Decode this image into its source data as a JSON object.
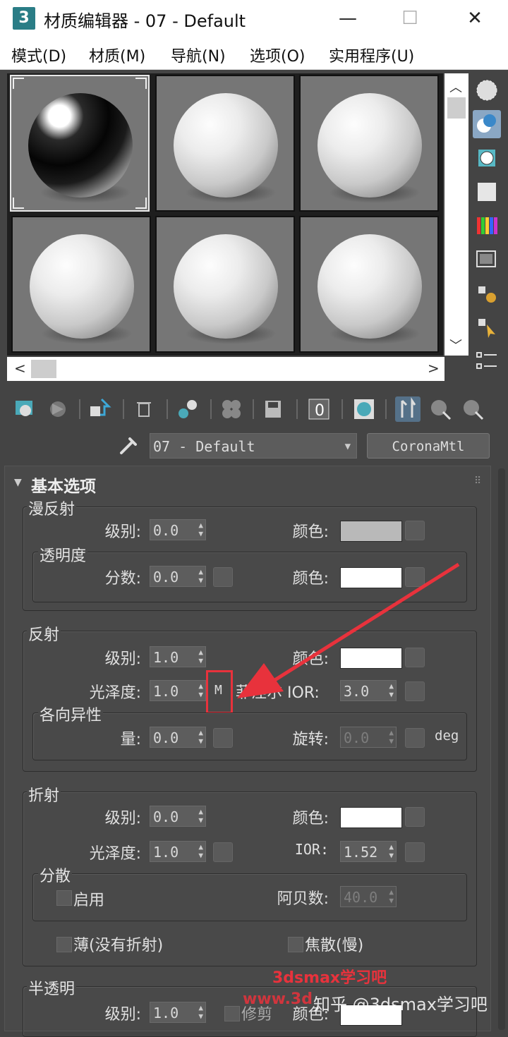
{
  "window": {
    "icon_label": "3",
    "title": "材质编辑器 - 07 - Default",
    "minimize": "—",
    "maximize": "☐",
    "close": "✕"
  },
  "menu": [
    "模式(D)",
    "材质(M)",
    "导航(N)",
    "选项(O)",
    "实用程序(U)"
  ],
  "material_name": "07 - Default",
  "material_type": "CoronaMtl",
  "rollout_title": "基本选项",
  "diffuse": {
    "title": "漫反射",
    "level_label": "级别:",
    "level_value": "0.0",
    "color_label": "颜色:",
    "color": "#b9b9b9"
  },
  "translucency_sub": {
    "title": "透明度",
    "fraction_label": "分数:",
    "fraction_value": "0.0",
    "color_label": "颜色:",
    "color": "#ffffff"
  },
  "reflection": {
    "title": "反射",
    "level_label": "级别:",
    "level_value": "1.0",
    "color_label": "颜色:",
    "color": "#ffffff",
    "gloss_label": "光泽度:",
    "gloss_value": "1.0",
    "m_label": "M",
    "fresnel_label": "菲涅尔 IOR:",
    "fresnel_value": "3.0"
  },
  "anisotropy": {
    "title": "各向异性",
    "amount_label": "量:",
    "amount_value": "0.0",
    "rotation_label": "旋转:",
    "rotation_value": "0.0",
    "unit": "deg"
  },
  "refraction": {
    "title": "折射",
    "level_label": "级别:",
    "level_value": "0.0",
    "color_label": "颜色:",
    "color": "#ffffff",
    "gloss_label": "光泽度:",
    "gloss_value": "1.0",
    "ior_label": "IOR:",
    "ior_value": "1.52"
  },
  "dispersion": {
    "title": "分散",
    "enable_label": "启用",
    "abbe_label": "阿贝数:",
    "abbe_value": "40.0"
  },
  "thin_label": "薄(没有折射)",
  "caustics_label": "焦散(慢)",
  "translucency": {
    "title": "半透明",
    "level_label": "级别:",
    "level_value": "1.0",
    "clip_label": "修剪",
    "color_label": "颜色:"
  },
  "watermark": {
    "line1": "3dsmax学习吧",
    "line2": "www.3d",
    "line3": "知乎 @3dsmax学习吧"
  },
  "accent_colors": {
    "highlight": "#e8323c",
    "title_icon": "#2a7d86"
  }
}
